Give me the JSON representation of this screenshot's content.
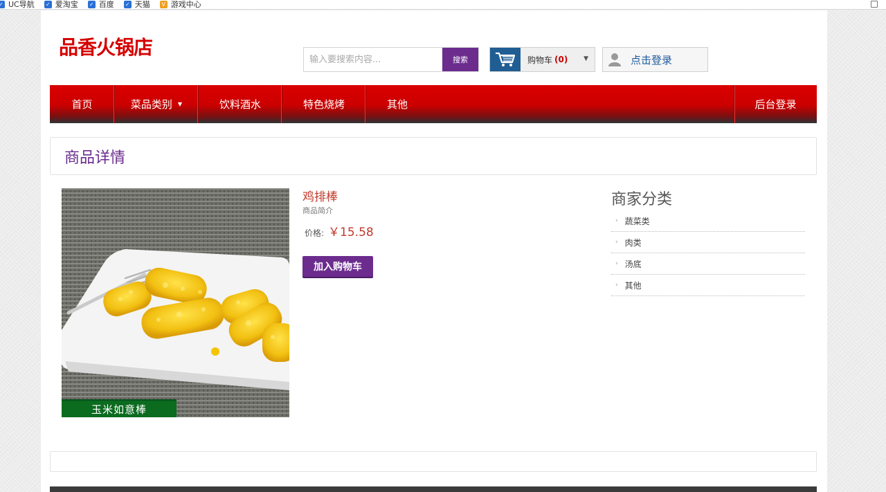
{
  "bookmarks": [
    {
      "label": "UC导航",
      "icon": "uc-icon"
    },
    {
      "label": "爱淘宝",
      "icon": "taobao-icon"
    },
    {
      "label": "百度",
      "icon": "baidu-icon"
    },
    {
      "label": "天猫",
      "icon": "tmall-icon"
    },
    {
      "label": "游戏中心",
      "icon": "game-icon"
    }
  ],
  "header": {
    "logo": "品香火锅店",
    "search_placeholder": "输入要搜索内容...",
    "search_button": "搜索",
    "cart_label": "购物车",
    "cart_count": "(0)",
    "login_label": "点击登录"
  },
  "nav": {
    "home": "首页",
    "categories": "菜品类别",
    "drinks": "饮料酒水",
    "bbq": "特色烧烤",
    "other": "其他",
    "admin": "后台登录"
  },
  "detail": {
    "title": "商品详情",
    "image_caption": "玉米如意棒",
    "product_name": "鸡排棒",
    "product_intro": "商品简介",
    "price_label": "价格:",
    "price_value": "￥15.58",
    "add_to_cart": "加入购物车"
  },
  "sidebar": {
    "title": "商家分类",
    "items": [
      {
        "label": "蔬菜类"
      },
      {
        "label": "肉类"
      },
      {
        "label": "汤底"
      },
      {
        "label": "其他"
      }
    ]
  },
  "colors": {
    "brand_red": "#d60000",
    "accent_purple": "#6b2c8e",
    "price_red": "#c0392b"
  }
}
